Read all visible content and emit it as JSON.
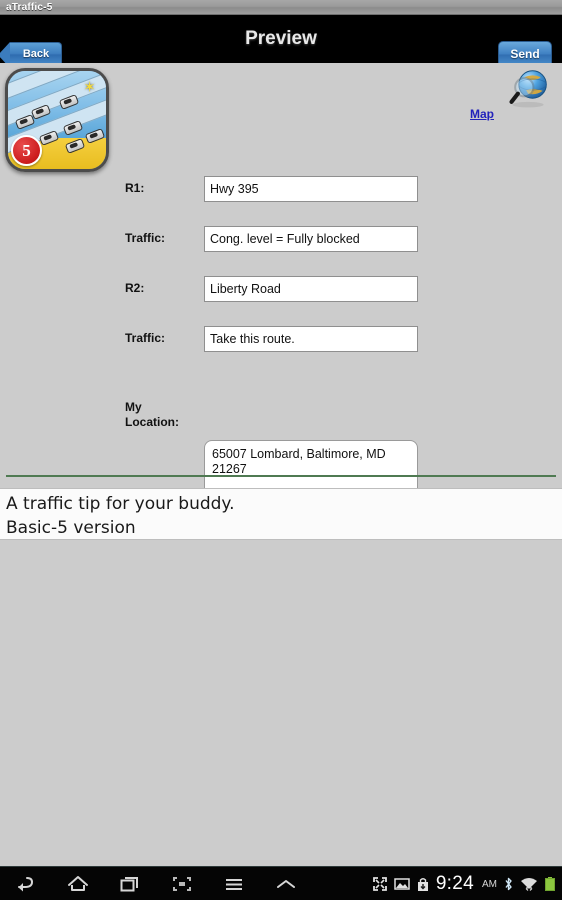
{
  "os": {
    "title": "aTraffic-5"
  },
  "header": {
    "title": "Preview",
    "back_label": "Back",
    "send_label": "Send"
  },
  "app_icon": {
    "badge_number": "5",
    "name": "traffic-jam-app-icon"
  },
  "map_link": {
    "label": "Map",
    "icon": "globe-magnifier-icon"
  },
  "form": {
    "fields": [
      {
        "label": "R1:",
        "value": "Hwy 395",
        "name": "route1"
      },
      {
        "label": "Traffic:",
        "value": "Cong. level = Fully blocked",
        "name": "traffic1"
      },
      {
        "label": "R2:",
        "value": "Liberty Road",
        "name": "route2"
      },
      {
        "label": "Traffic:",
        "value": "Take this route.",
        "name": "traffic2"
      }
    ],
    "location": {
      "label_line1": "My",
      "label_line2": "Location:",
      "value": "65007 Lombard, Baltimore, MD 21267"
    }
  },
  "message": {
    "line1": "A traffic tip for your buddy.",
    "line2": "Basic-5 version"
  },
  "navbar": {
    "buttons": [
      {
        "name": "back-nav-icon"
      },
      {
        "name": "home-nav-icon"
      },
      {
        "name": "recents-nav-icon"
      },
      {
        "name": "screenshot-nav-icon"
      },
      {
        "name": "menu-nav-icon"
      },
      {
        "name": "expand-up-nav-icon"
      }
    ],
    "status": {
      "time": "9:24",
      "ampm": "AM",
      "icons": [
        "fullscreen-icon",
        "image-icon",
        "download-icon",
        "bluetooth-icon",
        "wifi-icon",
        "battery-icon"
      ],
      "battery_color": "#8cc63f"
    }
  },
  "colors": {
    "background": "#cccccc",
    "header_bg": "#000000",
    "accent_blue": "#3f80c2",
    "link_blue": "#2222bb",
    "divider_green": "#4f7a52"
  }
}
